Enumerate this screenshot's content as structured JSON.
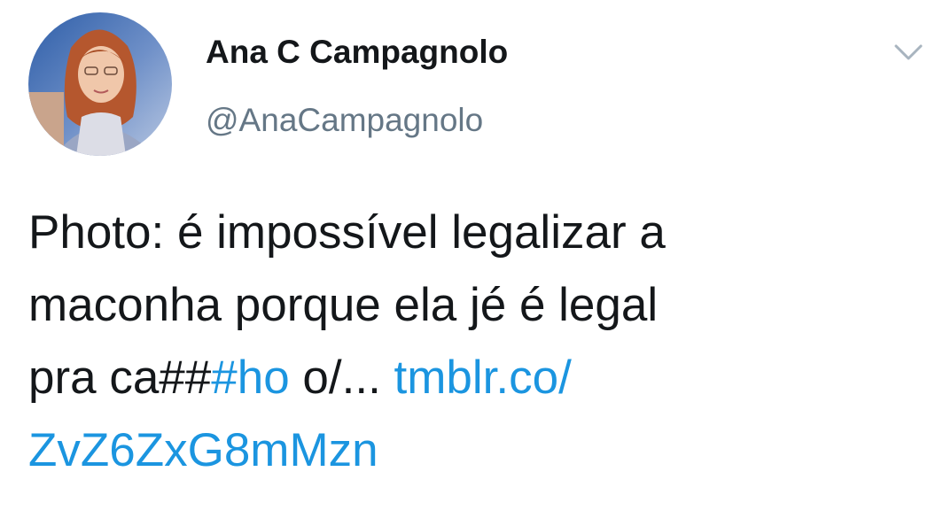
{
  "tweet": {
    "display_name": "Ana C Campagnolo",
    "handle": "@AnaCampagnolo",
    "text": {
      "line1": "Photo: é impossível legalizar a",
      "line2": "maconha porque ela jé é legal",
      "line3_plain": "pra ca##",
      "hashtag": "#ho",
      "line3_after": " o/... ",
      "link_part1": "tmblr.co/",
      "link_part2": "ZvZ6ZxG8mMzn"
    }
  },
  "icons": {
    "avatar": "avatar-photo",
    "caret": "chevron-down-icon"
  },
  "colors": {
    "text": "#14171a",
    "secondary": "#657786",
    "link": "#1b95e0"
  }
}
